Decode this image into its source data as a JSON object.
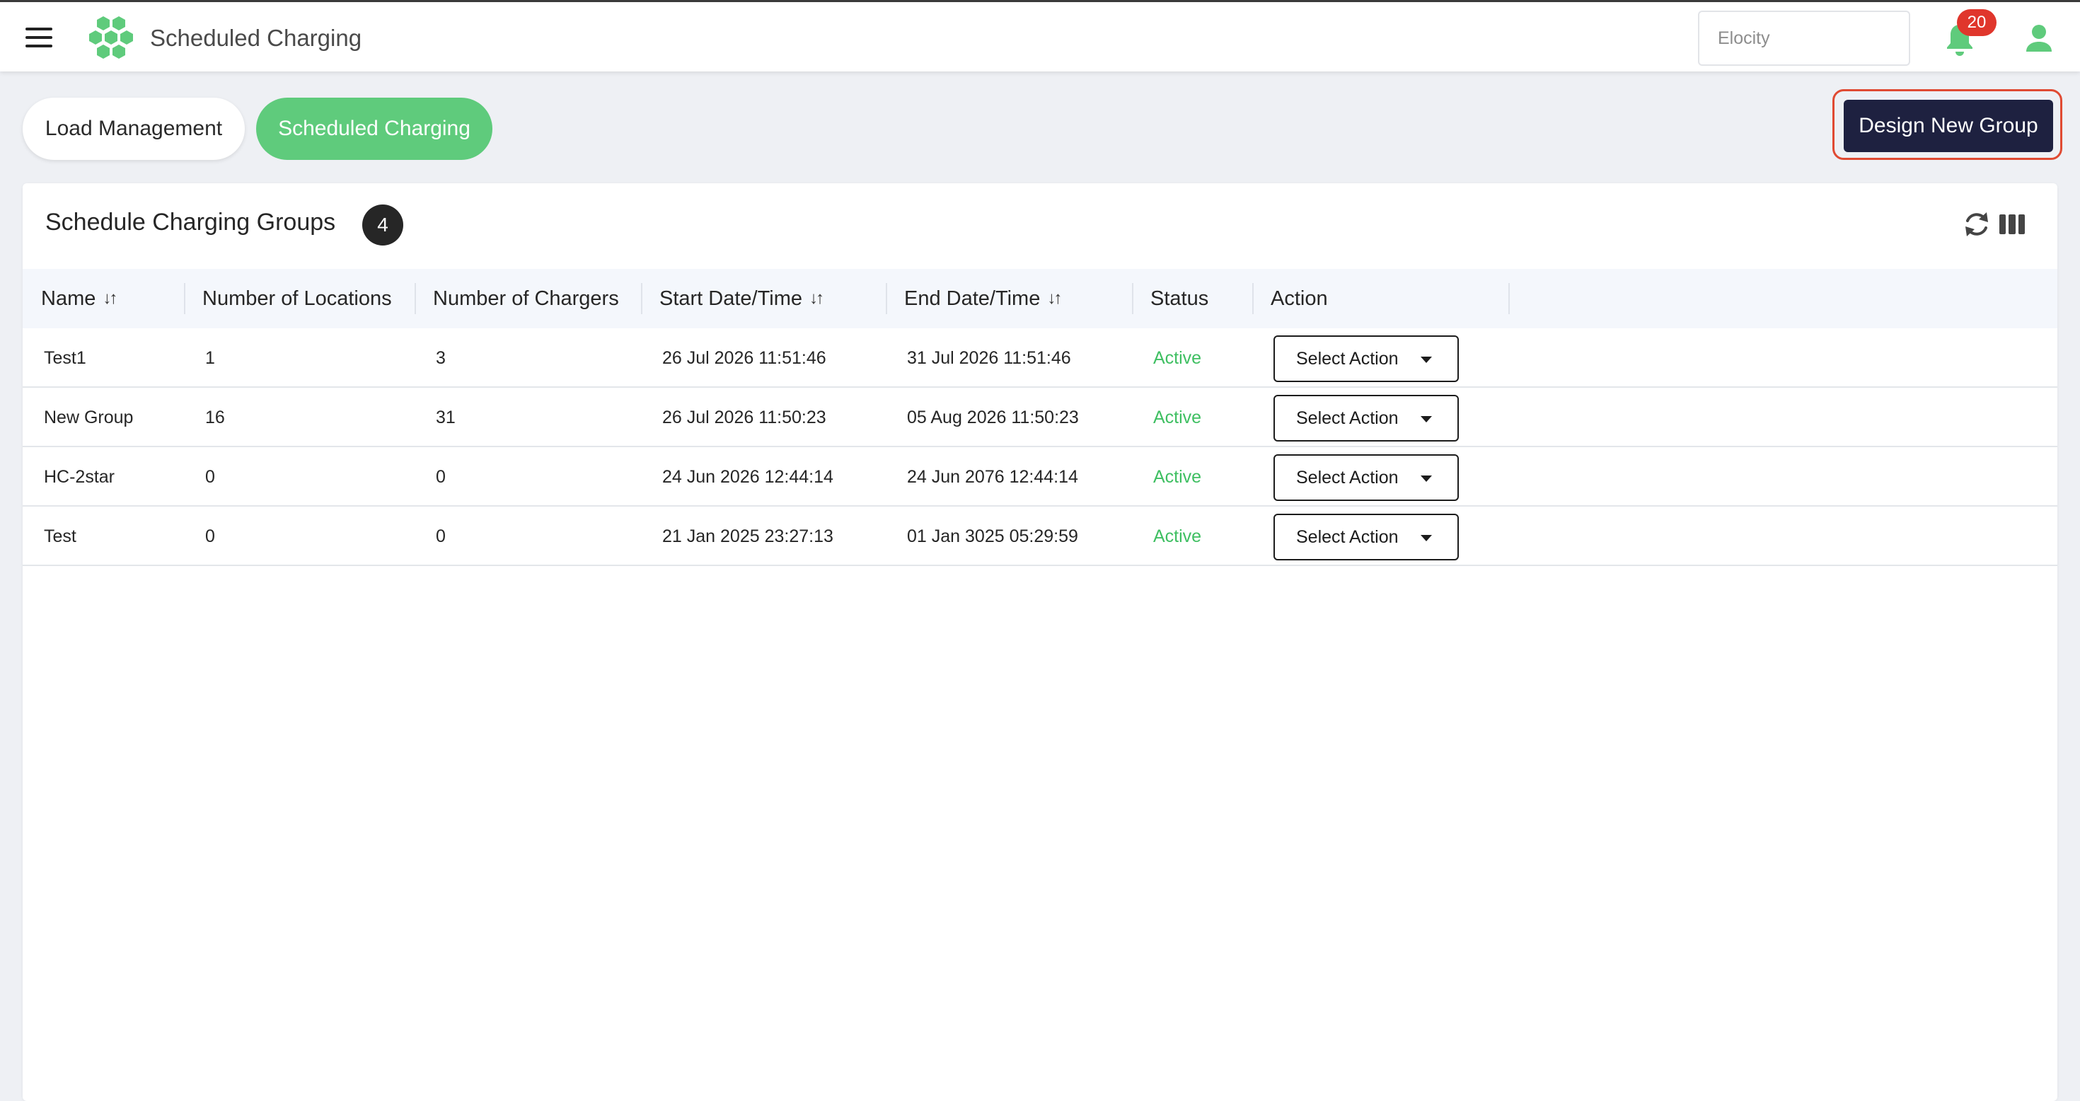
{
  "header": {
    "title": "Scheduled Charging",
    "search_placeholder": "Elocity",
    "notification_count": "20"
  },
  "tabs": [
    {
      "label": "Load Management",
      "active": false
    },
    {
      "label": "Scheduled Charging",
      "active": true
    }
  ],
  "design_button_label": "Design New Group",
  "card": {
    "title": "Schedule Charging Groups",
    "count": "4"
  },
  "table": {
    "columns": [
      {
        "label": "Name",
        "sortable": true
      },
      {
        "label": "Number of Locations",
        "sortable": false
      },
      {
        "label": "Number of Chargers",
        "sortable": false
      },
      {
        "label": "Start Date/Time",
        "sortable": true
      },
      {
        "label": "End Date/Time",
        "sortable": true
      },
      {
        "label": "Status",
        "sortable": false
      },
      {
        "label": "Action",
        "sortable": false
      }
    ],
    "sort_glyph": "↓↑",
    "rows": [
      {
        "name": "Test1",
        "locations": "1",
        "chargers": "3",
        "start": "26 Jul 2026 11:51:46",
        "end": "31 Jul 2026 11:51:46",
        "status": "Active",
        "action": "Select Action"
      },
      {
        "name": "New Group",
        "locations": "16",
        "chargers": "31",
        "start": "26 Jul 2026 11:50:23",
        "end": "05 Aug 2026 11:50:23",
        "status": "Active",
        "action": "Select Action"
      },
      {
        "name": "HC-2star",
        "locations": "0",
        "chargers": "0",
        "start": "24 Jun 2026 12:44:14",
        "end": "24 Jun 2076 12:44:14",
        "status": "Active",
        "action": "Select Action"
      },
      {
        "name": "Test",
        "locations": "0",
        "chargers": "0",
        "start": "21 Jan 2025 23:27:13",
        "end": "01 Jan 3025 05:29:59",
        "status": "Active",
        "action": "Select Action"
      }
    ]
  },
  "colors": {
    "accent_green": "#5fcb7c",
    "status_active": "#3fbf62",
    "primary_dark": "#1e2140",
    "badge_red": "#e0362c",
    "highlight_outline": "#e04a32"
  },
  "icons": [
    "menu-icon",
    "logo-hexagons-icon",
    "bell-icon",
    "user-icon",
    "refresh-icon",
    "columns-icon",
    "sort-icon",
    "caret-down-icon"
  ]
}
